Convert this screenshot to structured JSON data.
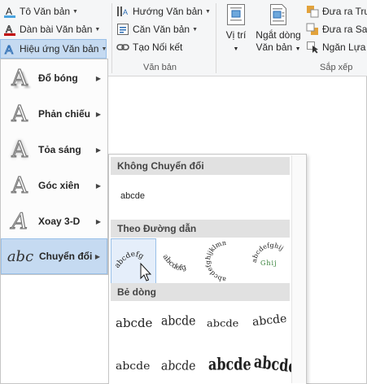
{
  "ribbon": {
    "text_fill": "Tô Văn bản",
    "text_outline": "Dàn bài Văn bản",
    "text_effects": "Hiệu ứng Văn bản",
    "text_direction": "Hướng Văn bản",
    "align_text": "Căn Văn bản",
    "create_link": "Tạo Nối kết",
    "group_text": "Văn bản",
    "position_l1": "Vị trí",
    "position_l2": "",
    "wrap_l1": "Ngắt dòng",
    "wrap_l2": "Văn bản",
    "bring_forward": "Đưa ra Trư",
    "send_backward": "Đưa ra Sau",
    "selection_pane": "Ngăn Lựa",
    "group_arrange": "Sắp xếp"
  },
  "menu": {
    "items": [
      {
        "label": "Đổ bóng",
        "icon": "A"
      },
      {
        "label": "Phản chiếu",
        "icon": "A"
      },
      {
        "label": "Tỏa sáng",
        "icon": "A"
      },
      {
        "label": "Góc xiên",
        "icon": "A"
      },
      {
        "label": "Xoay 3-D",
        "icon": "A"
      },
      {
        "label": "Chuyển đổi",
        "icon": "abc"
      }
    ]
  },
  "gallery": {
    "no_transform": "Không Chuyển đổi",
    "plain_sample": "abcde",
    "follow_path": "Theo Đường dẫn",
    "warp": "Bẻ dòng",
    "path_samples": [
      "abcdefg",
      "abcdefg",
      "abcdefghijklmn",
      "abcdefghij"
    ],
    "warp_samples": [
      "abcde",
      "abcde",
      "abcde",
      "abcde",
      "abcde",
      "abcde",
      "abcde",
      "abcde"
    ]
  },
  "colors": {
    "accent_blue": "#2b579a",
    "selection": "#c5daf1",
    "outline_red": "#c00000"
  }
}
